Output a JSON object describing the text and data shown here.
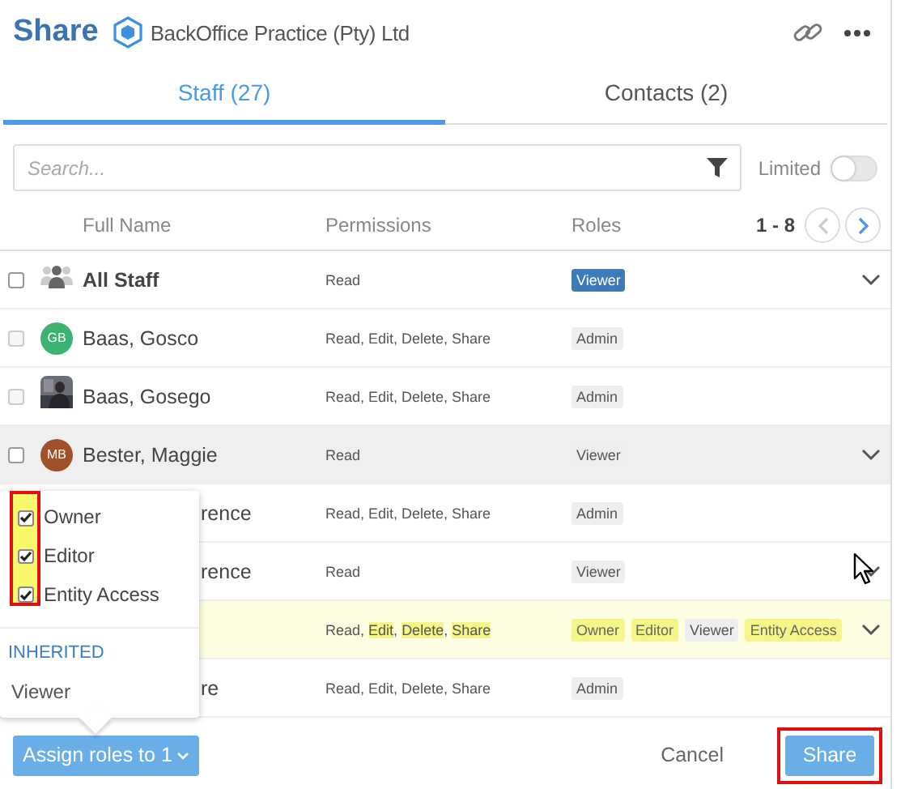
{
  "header": {
    "title": "Share",
    "organization": "BackOffice Practice (Pty) Ltd"
  },
  "tabs": [
    {
      "label": "Staff (27)",
      "selected": true
    },
    {
      "label": "Contacts (2)",
      "selected": false
    }
  ],
  "search": {
    "placeholder": "Search..."
  },
  "limited_toggle": {
    "label": "Limited",
    "on": false
  },
  "table": {
    "columns": [
      "Full Name",
      "Permissions",
      "Roles"
    ],
    "pagination": {
      "range": "1 - 8",
      "previous_disabled": true,
      "next_disabled": false
    },
    "rows": [
      {
        "covered": false,
        "checked": false,
        "disabled": false,
        "avatar": {
          "kind": "group"
        },
        "name": "All Staff",
        "permissions": [
          {
            "text": "Read",
            "highlighted": false
          }
        ],
        "roles": [
          {
            "label": "Viewer",
            "kind": "primary"
          }
        ],
        "expandable": true,
        "hovered": false,
        "selected": false
      },
      {
        "covered": false,
        "checked": false,
        "disabled": true,
        "avatar": {
          "kind": "initials",
          "initials": "GB",
          "color": "#3cb371"
        },
        "name": "Baas, Gosco",
        "permissions": [
          {
            "text": "Read, Edit, Delete, Share",
            "highlighted": false
          }
        ],
        "roles": [
          {
            "label": "Admin",
            "kind": "default"
          }
        ],
        "expandable": false,
        "hovered": false,
        "selected": false
      },
      {
        "covered": false,
        "checked": false,
        "disabled": true,
        "avatar": {
          "kind": "picture"
        },
        "name": "Baas, Gosego",
        "permissions": [
          {
            "text": "Read, Edit, Delete, Share",
            "highlighted": false
          }
        ],
        "roles": [
          {
            "label": "Admin",
            "kind": "default"
          }
        ],
        "expandable": false,
        "hovered": false,
        "selected": false
      },
      {
        "covered": false,
        "checked": false,
        "disabled": false,
        "avatar": {
          "kind": "initials",
          "initials": "MB",
          "color": "#a0502a"
        },
        "name": "Bester, Maggie",
        "permissions": [
          {
            "text": "Read",
            "highlighted": false
          }
        ],
        "roles": [
          {
            "label": "Viewer",
            "kind": "default"
          }
        ],
        "expandable": true,
        "hovered": true,
        "selected": false
      },
      {
        "covered": true,
        "name": "rence",
        "permissions": [
          {
            "text": "Read, Edit, Delete, Share",
            "highlighted": false
          }
        ],
        "roles": [
          {
            "label": "Admin",
            "kind": "default"
          }
        ],
        "expandable": false,
        "hovered": false,
        "selected": false
      },
      {
        "covered": true,
        "name": "rence",
        "permissions": [
          {
            "text": "Read",
            "highlighted": false
          }
        ],
        "roles": [
          {
            "label": "Viewer",
            "kind": "default"
          }
        ],
        "expandable": true,
        "hovered": false,
        "selected": false
      },
      {
        "covered": true,
        "permissions": [
          {
            "text": "Read",
            "highlighted": false,
            "separator": ", "
          },
          {
            "text": "Edit",
            "highlighted": true,
            "separator": ", "
          },
          {
            "text": "Delete",
            "highlighted": true,
            "separator": ", "
          },
          {
            "text": "Share",
            "highlighted": true
          }
        ],
        "roles": [
          {
            "label": "Owner",
            "kind": "highlighted"
          },
          {
            "label": "Editor",
            "kind": "highlighted"
          },
          {
            "label": "Viewer",
            "kind": "default"
          },
          {
            "label": "Entity Access",
            "kind": "highlighted"
          }
        ],
        "expandable": true,
        "hovered": false,
        "selected": true
      },
      {
        "covered": true,
        "name": "re",
        "permissions": [
          {
            "text": "Read, Edit, Delete, Share",
            "highlighted": false
          }
        ],
        "roles": [
          {
            "label": "Admin",
            "kind": "default"
          }
        ],
        "expandable": false,
        "hovered": false,
        "selected": false
      }
    ]
  },
  "role_popover": {
    "annotated": true,
    "roles": [
      {
        "label": "Owner",
        "checked": true
      },
      {
        "label": "Editor",
        "checked": true
      },
      {
        "label": "Entity Access",
        "checked": true
      }
    ],
    "section": "INHERITED",
    "inherited": [
      "Viewer"
    ]
  },
  "footer": {
    "assign_button": "Assign roles to 1",
    "cancel": "Cancel",
    "share": {
      "label": "Share",
      "annotated": true
    }
  }
}
